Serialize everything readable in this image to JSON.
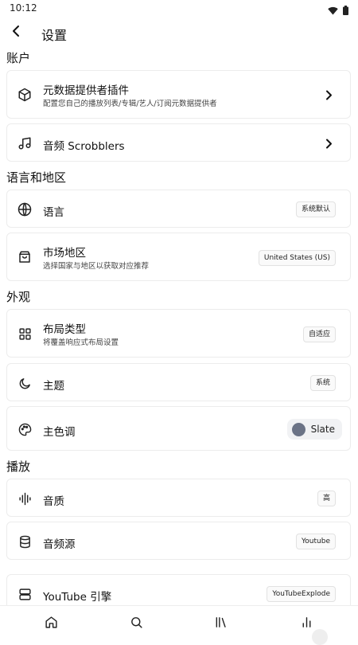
{
  "status": {
    "time": "10:12",
    "icons": [
      "wifi-icon",
      "battery-icon"
    ]
  },
  "appbar": {
    "title": "设置",
    "back_icon": "back-arrow-icon"
  },
  "sections": {
    "account": "账户",
    "language_region": "语言和地区",
    "appearance": "外观",
    "playback": "播放"
  },
  "items": {
    "metadata_plugins": {
      "title": "元数据提供者插件",
      "subtitle": "配置您自己的播放列表/专辑/艺人/订阅元数据提供者",
      "icon": "cube-icon"
    },
    "scrobblers": {
      "title": "音频 Scrobblers",
      "icon": "music-note-icon"
    },
    "language": {
      "title": "语言",
      "value": "系统默认",
      "icon": "globe-icon"
    },
    "market": {
      "title": "市场地区",
      "subtitle": "选择国家与地区以获取对应推荐",
      "value": "United States (US)",
      "icon": "shopping-bag-icon"
    },
    "layout": {
      "title": "布局类型",
      "subtitle": "将覆盖响应式布局设置",
      "value": "自适应",
      "icon": "grid-icon"
    },
    "theme": {
      "title": "主题",
      "value": "系统",
      "icon": "moon-icon"
    },
    "accent": {
      "title": "主色调",
      "value": "Slate",
      "swatch_color": "#6b7386",
      "icon": "palette-icon"
    },
    "audio_quality": {
      "title": "音质",
      "value": "高",
      "icon": "audio-wave-icon"
    },
    "audio_source": {
      "title": "音频源",
      "value": "Youtube",
      "icon": "database-icon"
    },
    "youtube_engine": {
      "title": "YouTube 引擎",
      "value": "YouTubeExplode",
      "icon": "server-icon"
    }
  },
  "bottom_nav": [
    "home-icon",
    "search-icon",
    "library-icon",
    "stats-icon"
  ],
  "colors": {
    "background": "#ffffff",
    "card_border": "#ececec",
    "text": "#111111"
  }
}
